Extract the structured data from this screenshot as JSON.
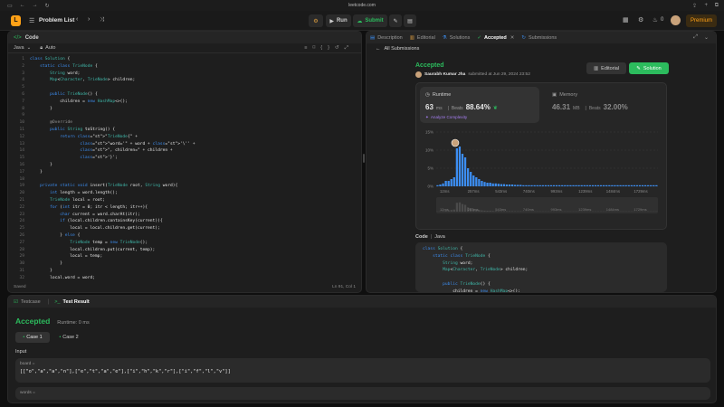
{
  "browser": {
    "url": "leetcode.com"
  },
  "topbar": {
    "problem_list": "Problem List",
    "run": "Run",
    "submit": "Submit",
    "notif_count": "0",
    "premium": "Premium"
  },
  "code_panel": {
    "title": "Code",
    "language": "Java",
    "auto": "Auto",
    "status_left": "Saved",
    "status_right": "Ln 91, Col 1"
  },
  "code_lines": [
    {
      "n": "1",
      "t": "class Solution {"
    },
    {
      "n": "2",
      "t": "    static class TrieNode {"
    },
    {
      "n": "3",
      "t": "        String word;"
    },
    {
      "n": "4",
      "t": "        Map<Character, TrieNode> children;"
    },
    {
      "n": "5",
      "t": ""
    },
    {
      "n": "6",
      "t": "        public TrieNode() {"
    },
    {
      "n": "7",
      "t": "            children = new HashMap<>();"
    },
    {
      "n": "8",
      "t": "        }"
    },
    {
      "n": "9",
      "t": ""
    },
    {
      "n": "10",
      "t": "        @Override"
    },
    {
      "n": "11",
      "t": "        public String toString() {"
    },
    {
      "n": "12",
      "t": "            return \"TrieNode{\" +"
    },
    {
      "n": "13",
      "t": "                    \"word='\" + word + '\\'' +"
    },
    {
      "n": "14",
      "t": "                    \", children=\" + children +"
    },
    {
      "n": "15",
      "t": "                    '}';"
    },
    {
      "n": "16",
      "t": "        }"
    },
    {
      "n": "17",
      "t": "    }"
    },
    {
      "n": "18",
      "t": ""
    },
    {
      "n": "19",
      "t": "    private static void insert(TrieNode root, String word){"
    },
    {
      "n": "20",
      "t": "        int length = word.length();"
    },
    {
      "n": "21",
      "t": "        TrieNode local = root;"
    },
    {
      "n": "22",
      "t": "        for (int itr = 0; itr < length; itr++){"
    },
    {
      "n": "23",
      "t": "            char current = word.charAt(itr);"
    },
    {
      "n": "24",
      "t": "            if (local.children.containsKey(current)){"
    },
    {
      "n": "25",
      "t": "                local = local.children.get(current);"
    },
    {
      "n": "26",
      "t": "            } else {"
    },
    {
      "n": "27",
      "t": "                TrieNode temp = new TrieNode();"
    },
    {
      "n": "28",
      "t": "                local.children.put(current, temp);"
    },
    {
      "n": "29",
      "t": "                local = temp;"
    },
    {
      "n": "30",
      "t": "            }"
    },
    {
      "n": "31",
      "t": "        }"
    },
    {
      "n": "32",
      "t": "        local.word = word;"
    }
  ],
  "right_tabs": {
    "description": "Description",
    "editorial": "Editorial",
    "solutions": "Solutions",
    "accepted": "Accepted",
    "submissions": "Submissions"
  },
  "submission": {
    "back": "All Submissions",
    "status": "Accepted",
    "user": "Saurabh Kumar Jha",
    "submitted": "submitted at Jun 29, 2024 23:52",
    "editorial_btn": "Editorial",
    "solution_btn": "Solution"
  },
  "runtime": {
    "label": "Runtime",
    "value": "63",
    "unit": "ms",
    "beats_label": "Beats",
    "beats": "88.64%",
    "analyze": "Analyze Complexity"
  },
  "memory": {
    "label": "Memory",
    "value": "46.31",
    "unit": "MB",
    "beats_label": "Beats",
    "beats": "32.00%"
  },
  "chart_data": {
    "type": "bar",
    "y_ticks": [
      "15%",
      "10%",
      "5%",
      "0%"
    ],
    "x_ticks": [
      "12ms",
      "257ms",
      "543ms",
      "740ms",
      "993ms",
      "1239ms",
      "1484ms",
      "1729ms"
    ],
    "ylim": [
      0,
      15
    ],
    "values": [
      0.3,
      0.5,
      0.8,
      1.5,
      1.5,
      2,
      2.5,
      10.5,
      11,
      9,
      8,
      5,
      4,
      3,
      2.5,
      2,
      1.5,
      1.2,
      1,
      1,
      0.8,
      0.8,
      0.7,
      0.6,
      0.6,
      0.5,
      0.5,
      0.5,
      0.4,
      0.4,
      0.4,
      0.3,
      0.3,
      0.3,
      0.3,
      0.3,
      0.3,
      0.3,
      0.3,
      0.3,
      0.3,
      0.3,
      0.3,
      0.3,
      0.3,
      0.3,
      0.3,
      0.3,
      0.3,
      0.3,
      0.3,
      0.3,
      0.3,
      0.3,
      0.3,
      0.3,
      0.3,
      0.3,
      0.3,
      0.3,
      0.3,
      0.3,
      0.3,
      0.3,
      0.3,
      0.3,
      0.3,
      0.3,
      0.3,
      0.3,
      0.3,
      0.3,
      0.3,
      0.3,
      0.3,
      0.3,
      0.3,
      0.3,
      0.3,
      0.3
    ],
    "highlight_index": 7,
    "bar_color": "#3c8df0"
  },
  "code_view": {
    "label": "Code",
    "lang": "Java",
    "lines": [
      "class Solution {",
      "    static class TrieNode {",
      "        String word;",
      "        Map<Character, TrieNode> children;",
      "",
      "        public TrieNode() {",
      "            children = new HashMap<>();"
    ]
  },
  "bottom": {
    "testcase_tab": "Testcase",
    "result_tab": "Test Result",
    "status": "Accepted",
    "runtime": "Runtime: 0 ms",
    "case1": "Case 1",
    "case2": "Case 2",
    "input_label": "Input",
    "board_label": "board =",
    "board_value": "[[\"o\",\"a\",\"a\",\"n\"],[\"e\",\"t\",\"a\",\"e\"],[\"i\",\"h\",\"k\",\"r\"],[\"i\",\"f\",\"l\",\"v\"]]",
    "words_label": "words ="
  }
}
